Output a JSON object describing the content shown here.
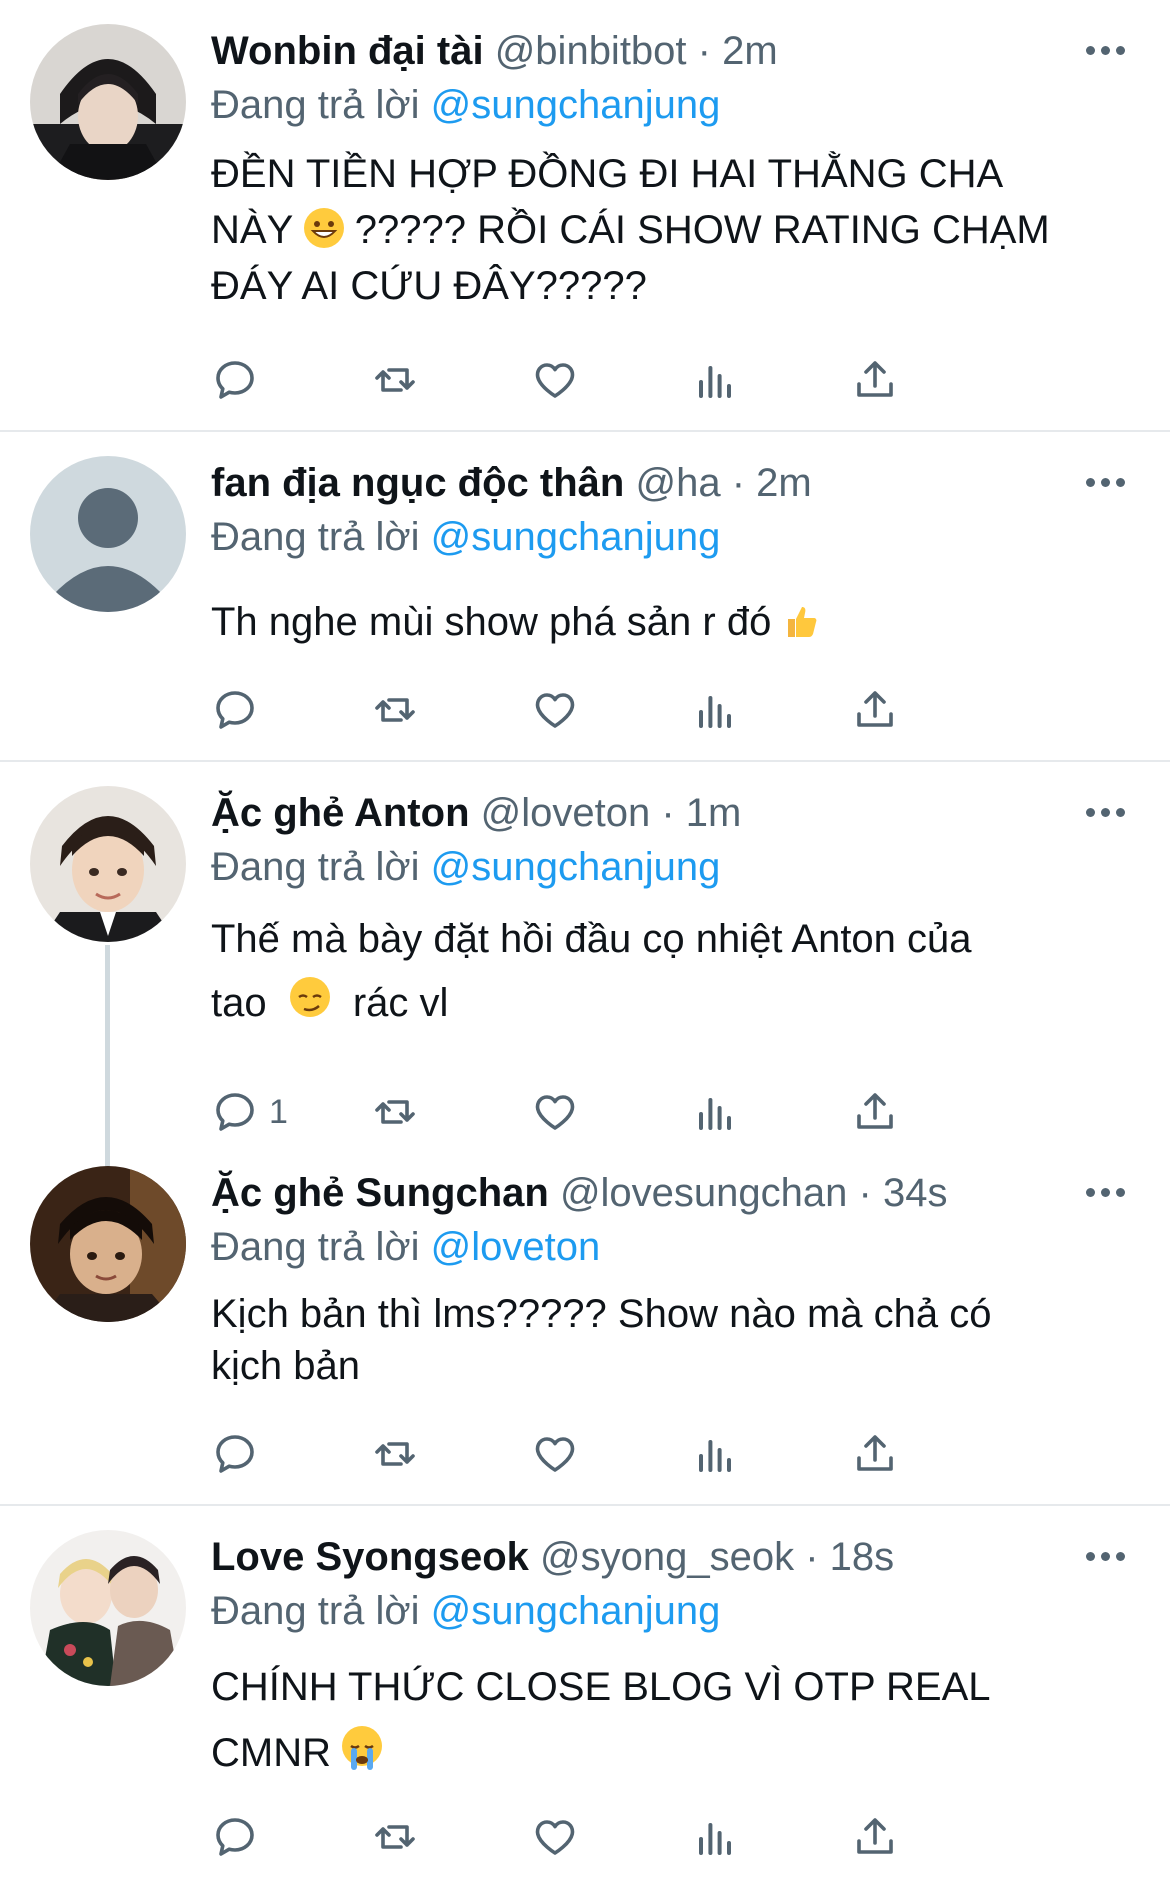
{
  "colors": {
    "link": "#1d9bf0",
    "secondary": "#536471",
    "text": "#0f1419",
    "divider": "#e6e9ec"
  },
  "tweets": [
    {
      "name": "Wonbin đại tài",
      "handle": "@binbitbot",
      "dot": "·",
      "time": "2m",
      "replying_prefix": "Đang trả lời",
      "replying_to": "@sungchanjung",
      "text_lines": [
        "ĐỀN TIỀN HỢP ĐỒNG ĐI HAI THẰNG CHA",
        "NÀY",
        "????? RỒI CÁI SHOW RATING CHẠM",
        "ĐÁY AI CỨU ĐÂY?????"
      ],
      "emoji": "grinning-face",
      "reply_count": ""
    },
    {
      "name": "fan địa ngục độc thân",
      "handle": "@ha",
      "dot": "·",
      "time": "2m",
      "replying_prefix": "Đang trả lời",
      "replying_to": "@sungchanjung",
      "text_lines": [
        "Th nghe mùi show phá sản r đó"
      ],
      "emoji": "thumbs-up",
      "reply_count": ""
    },
    {
      "name": "Ặc ghẻ Anton",
      "handle": "@loveton",
      "dot": "·",
      "time": "1m",
      "replying_prefix": "Đang trả lời",
      "replying_to": "@sungchanjung",
      "text_lines": [
        "Thế mà bày đặt hồi đầu cọ nhiệt Anton của",
        "tao",
        "rác vl"
      ],
      "emoji": "smirking-face",
      "reply_count": "1"
    },
    {
      "name": "Ặc ghẻ Sungchan",
      "handle": "@lovesungchan",
      "dot": "·",
      "time": "34s",
      "replying_prefix": "Đang trả lời",
      "replying_to": "@loveton",
      "text_lines": [
        "Kịch bản thì lms????? Show nào mà chả có",
        "kịch bản"
      ],
      "emoji": "",
      "reply_count": ""
    },
    {
      "name": "Love Syongseok",
      "handle": "@syong_seok",
      "dot": "·",
      "time": "18s",
      "replying_prefix": "Đang trả lời",
      "replying_to": "@sungchanjung",
      "text_lines": [
        "CHÍNH THỨC CLOSE BLOG VÌ OTP REAL",
        "CMNR"
      ],
      "emoji": "loudly-crying-face",
      "reply_count": ""
    }
  ],
  "action_icons": [
    "reply-icon",
    "retweet-icon",
    "like-icon",
    "analytics-icon",
    "share-icon"
  ]
}
